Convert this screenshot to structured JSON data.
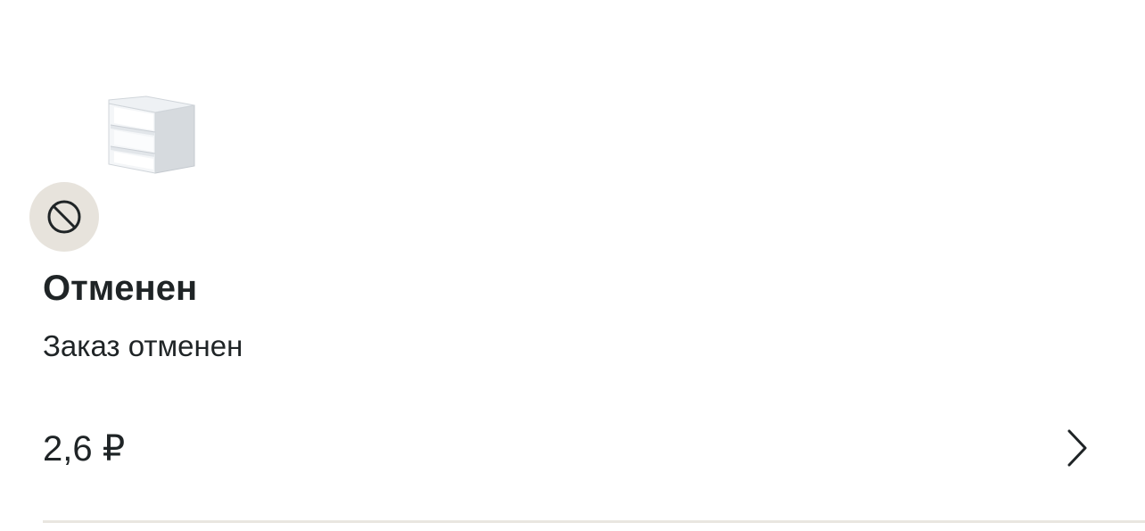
{
  "order": {
    "status_title": "Отменен",
    "status_subtitle": "Заказ отменен",
    "price": "2,6 ₽"
  },
  "icons": {
    "status": "cancel-icon",
    "product": "product-thumbnail-shelf-unit",
    "navigation": "chevron-right-icon"
  },
  "colors": {
    "status_badge_bg": "#e7e3dc",
    "text": "#1f2426",
    "divider": "#e9e6e0"
  }
}
